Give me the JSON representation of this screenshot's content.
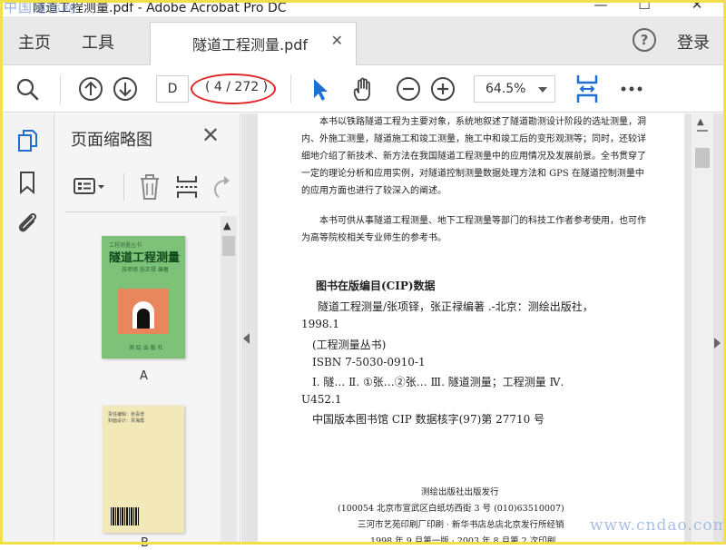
{
  "window": {
    "title": "隧道工程测量.pdf - Adobe Acrobat Pro DC",
    "watermark_top": "中国道标网",
    "minimize": "—",
    "maximize": "☐",
    "close": "✕"
  },
  "menubar": {
    "home": "主页",
    "tools": "工具",
    "doc_tab": "隧道工程测量.pdf",
    "doc_tab_close": "✕",
    "help": "?",
    "login": "登录"
  },
  "toolbar": {
    "page_input": "D",
    "page_count": "( 4 / 272 )",
    "zoom": "64.5%",
    "icons": [
      "search-icon",
      "page-up-icon",
      "page-down-icon",
      "select-cursor-icon",
      "hand-icon",
      "zoom-out-icon",
      "zoom-in-icon",
      "fit-width-icon",
      "more-icon"
    ],
    "accent_color": "#1f6fd1",
    "highlight_color": "#e22424"
  },
  "sidebar": {
    "panel_title": "页面缩略图",
    "close": "✕",
    "rail_icons": [
      "page-thumbnails-icon",
      "bookmark-icon",
      "attachment-icon"
    ],
    "tool_icons": [
      "thumbnail-options-icon",
      "delete-icon",
      "crop-icon",
      "rotate-icon"
    ],
    "thumbnails": [
      {
        "label": "A",
        "cover_top": "工程测量丛书",
        "cover_title": "隧道工程测量",
        "cover_authors": "张项铎  张正禄  编著",
        "cover_publisher": "测 绘 出 版 社"
      },
      {
        "label": "B",
        "back_text": [
          "责任编辑：张喜增",
          "封面设计：贾海霞"
        ]
      }
    ]
  },
  "document": {
    "paragraphs": [
      "本书以铁路隧道工程为主要对象，系统地叙述了隧道勘测设计阶段的选址测量，洞内、外施工测量，隧道施工和竣工测量，施工中和竣工后的变形观测等；同时，还较详细地介绍了新技术、新方法在我国隧道工程测量中的应用情况及发展前景。全书贯穿了一定的理论分析和应用实例，对隧道控制测量数据处理方法和 GPS 在隧道控制测量中的应用方面也进行了较深入的阐述。",
      "本书可供从事隧道工程测量、地下工程测量等部门的科技工作者参考使用，也可作为高等院校相关专业师生的参考书。"
    ],
    "cip_title": "图书在版编目(CIP)数据",
    "cip_lines": [
      "隧道工程测量/张项铎，张正禄编著 .-北京：测绘出版社，",
      "1998.1",
      "(工程测量丛书)",
      "ISBN 7-5030-0910-1",
      "Ⅰ. 隧…   Ⅱ. ①张…②张…   Ⅲ. 隧道测量；工程测量   Ⅳ.",
      "U452.1",
      "中国版本图书馆 CIP 数据核字(97)第 27710 号"
    ],
    "publisher_lines": [
      "测绘出版社出版发行",
      "(100054   北京市宣武区白纸坊西街 3 号   (010)63510007)",
      "三河市艺苑印刷厂印刷 · 新华书店总店北京发行所经销",
      "1998 年 9 月第一版 · 2003 年 8 月第 2 次印刷"
    ],
    "watermark": "www.cndao.com"
  }
}
